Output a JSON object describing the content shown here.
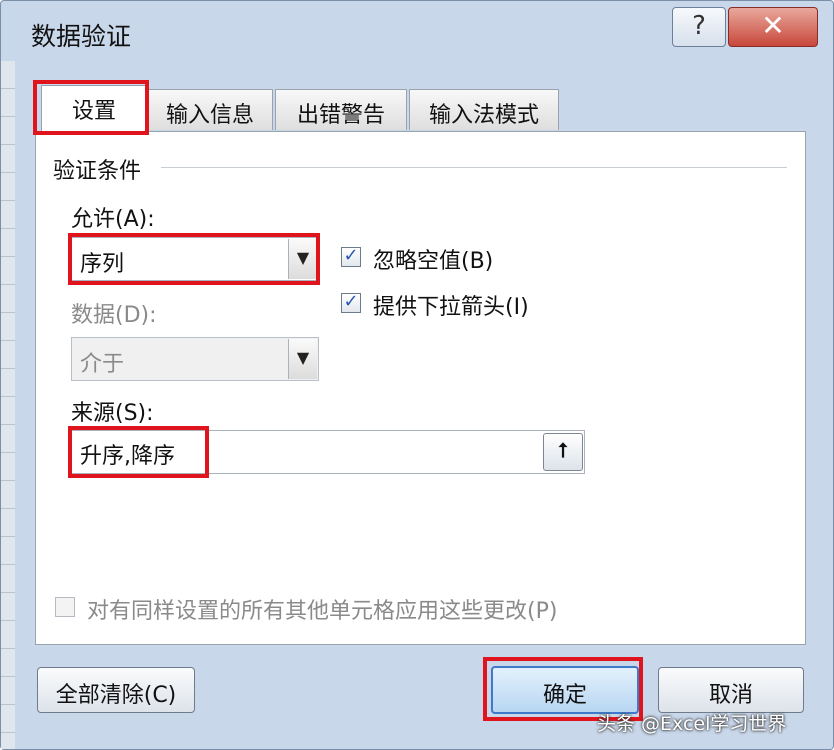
{
  "window": {
    "title": "数据验证",
    "help_label": "?",
    "close_label": "✕"
  },
  "tabs": [
    {
      "label": "设置",
      "active": true
    },
    {
      "label": "输入信息",
      "active": false
    },
    {
      "label": "出错警告",
      "active": false
    },
    {
      "label": "输入法模式",
      "active": false
    }
  ],
  "settings": {
    "group_label": "验证条件",
    "allow_label": "允许(A):",
    "allow_value": "序列",
    "data_label": "数据(D):",
    "data_value": "介于",
    "ignore_blank_label": "忽略空值(B)",
    "ignore_blank_checked": true,
    "dropdown_label": "提供下拉箭头(I)",
    "dropdown_checked": true,
    "source_label": "来源(S):",
    "source_value": "升序,降序",
    "apply_all_label": "对有同样设置的所有其他单元格应用这些更改(P)",
    "apply_all_checked": false
  },
  "buttons": {
    "clear_all": "全部清除(C)",
    "ok": "确定",
    "cancel": "取消"
  },
  "icons": {
    "collapse": "upload-arrow-icon",
    "dropdown": "chevron-down-icon",
    "check": "check-icon"
  },
  "highlight_color": "#e0141c",
  "watermark": "头条 @Excel学习世界"
}
